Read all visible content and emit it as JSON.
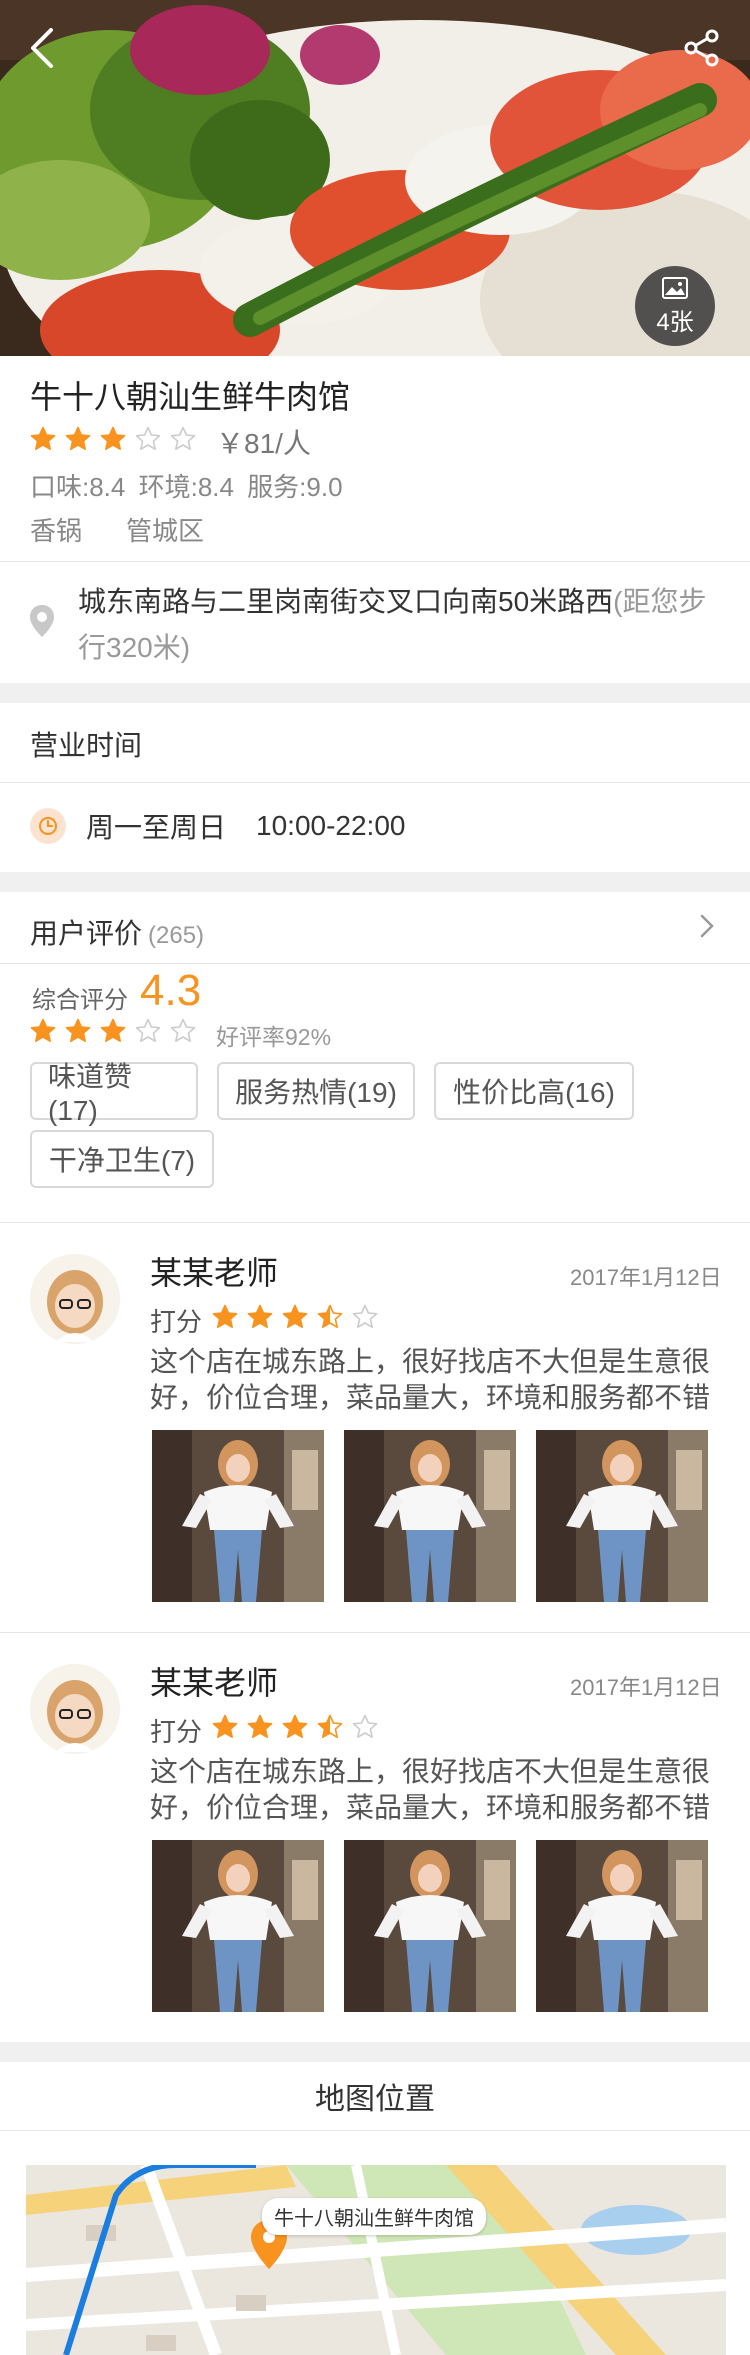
{
  "header": {
    "back_icon": "chevron-left-icon",
    "share_icon": "share-icon",
    "photo_count": "4张"
  },
  "restaurant": {
    "name": "牛十八朝汕生鲜牛肉馆",
    "rating_stars": 3,
    "rating_max": 5,
    "price": "￥81/人",
    "scores": "口味:8.4  环境:8.4  服务:9.0",
    "tags": [
      "香锅",
      "管城区"
    ]
  },
  "address": {
    "text": "城东南路与二里岗南街交叉口向南50米路西",
    "distance": "(距您步行320米)"
  },
  "hours": {
    "title": "营业时间",
    "days": "周一至周日",
    "time": "10:00-22:00"
  },
  "reviews": {
    "title": "用户评价",
    "count": "(265)",
    "overall_label": "综合评分",
    "overall_score": "4.3",
    "overall_stars": 3,
    "good_rate": "好评率92%",
    "tags": [
      "味道赞(17)",
      "服务热情(19)",
      "性价比高(16)",
      "干净卫生(7)"
    ],
    "items": [
      {
        "name": "某某老师",
        "date": "2017年1月12日",
        "score_label": "打分",
        "stars": 3.5,
        "text": "这个店在城东路上，很好找店不大但是生意很好，价位合理，菜品量大，环境和服务都不错"
      },
      {
        "name": "某某老师",
        "date": "2017年1月12日",
        "score_label": "打分",
        "stars": 3.5,
        "text": "这个店在城东路上，很好找店不大但是生意很好，价位合理，菜品量大，环境和服务都不错"
      }
    ]
  },
  "map": {
    "title": "地图位置",
    "label": "牛十八朝汕生鲜牛肉馆"
  },
  "colors": {
    "accent": "#f7931e",
    "star_empty": "#cccccc",
    "divider": "#e6e6e6",
    "gap": "#f0f0f0"
  }
}
